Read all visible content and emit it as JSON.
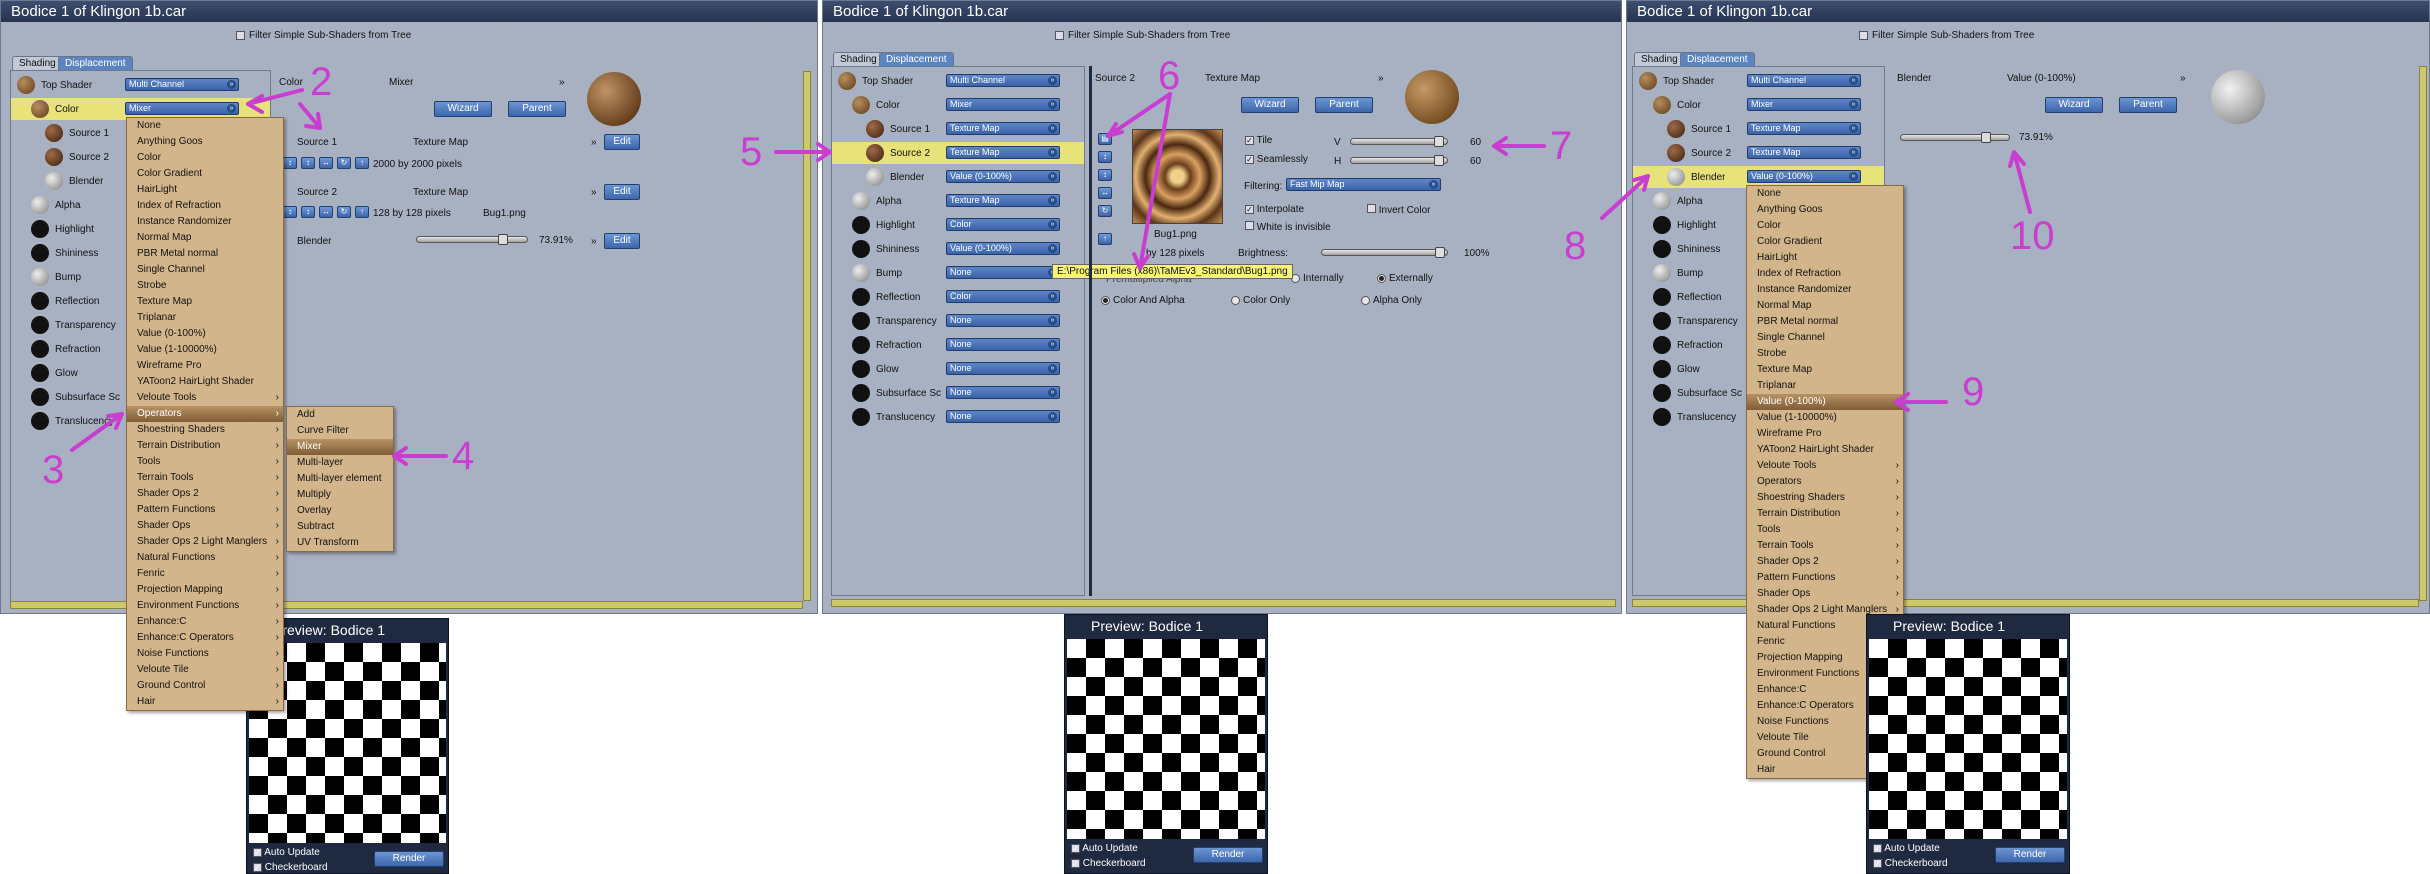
{
  "window_title": "Bodice 1 of Klingon 1b.car",
  "filter_label": "Filter Simple Sub-Shaders from Tree",
  "tabs": [
    "Shading",
    "Displacement"
  ],
  "buttons": {
    "wizard": "Wizard",
    "parent": "Parent",
    "edit": "Edit",
    "render": "Render"
  },
  "preview": {
    "title": "Preview: Bodice 1",
    "auto_update": "Auto Update",
    "checkerboard": "Checkerboard"
  },
  "p1": {
    "tree": [
      {
        "label": "Top Shader",
        "value": "Multi Channel"
      },
      {
        "label": "Color",
        "value": "Mixer"
      },
      {
        "label": "Source 1",
        "value": ""
      },
      {
        "label": "Source 2",
        "value": ""
      },
      {
        "label": "Blender",
        "value": ""
      },
      {
        "label": "Alpha",
        "value": ""
      },
      {
        "label": "Highlight",
        "value": ""
      },
      {
        "label": "Shininess",
        "value": ""
      },
      {
        "label": "Bump",
        "value": ""
      },
      {
        "label": "Reflection",
        "value": ""
      },
      {
        "label": "Transparency",
        "value": ""
      },
      {
        "label": "Refraction",
        "value": ""
      },
      {
        "label": "Glow",
        "value": ""
      },
      {
        "label": "Subsurface Sc",
        "value": ""
      },
      {
        "label": "Translucency",
        "value": ""
      }
    ],
    "header": {
      "channel": "Color",
      "type": "Mixer"
    },
    "source1": {
      "label": "Source 1",
      "type": "Texture Map",
      "info": "2000 by 2000 pixels"
    },
    "source2": {
      "label": "Source 2",
      "type": "Texture Map",
      "info": "128 by 128 pixels",
      "file": "Bug1.png"
    },
    "blender": {
      "label": "Blender",
      "value": "73.91%"
    },
    "menu": [
      "None",
      "Anything Goos",
      "Color",
      "Color Gradient",
      "HairLight",
      "Index of Refraction",
      "Instance Randomizer",
      "Normal Map",
      "PBR Metal normal",
      "Single Channel",
      "Strobe",
      "Texture Map",
      "Triplanar",
      "Value (0-100%)",
      "Value (1-10000%)",
      "Wireframe Pro",
      "YAToon2 HairLight Shader",
      "Veloute Tools",
      "Operators",
      "Shoestring Shaders",
      "Terrain Distribution",
      "Tools",
      "Terrain Tools",
      "Shader Ops 2",
      "Pattern Functions",
      "Shader Ops",
      "Shader Ops 2 Light Manglers",
      "Natural Functions",
      "Fenric",
      "Projection Mapping",
      "Environment Functions",
      "Enhance:C",
      "Enhance:C Operators",
      "Noise Functions",
      "Veloute Tile",
      "Ground Control",
      "Hair"
    ],
    "submenu": [
      "Add",
      "Curve Filter",
      "Mixer",
      "Multi-layer",
      "Multi-layer element",
      "Multiply",
      "Overlay",
      "Subtract",
      "UV Transform"
    ]
  },
  "p2": {
    "tree": [
      {
        "label": "Top Shader",
        "value": "Multi Channel"
      },
      {
        "label": "Color",
        "value": "Mixer"
      },
      {
        "label": "Source 1",
        "value": "Texture Map"
      },
      {
        "label": "Source 2",
        "value": "Texture Map"
      },
      {
        "label": "Blender",
        "value": "Value (0-100%)"
      },
      {
        "label": "Alpha",
        "value": "Texture Map"
      },
      {
        "label": "Highlight",
        "value": "Color"
      },
      {
        "label": "Shininess",
        "value": "Value (0-100%)"
      },
      {
        "label": "Bump",
        "value": "None"
      },
      {
        "label": "Reflection",
        "value": "Color"
      },
      {
        "label": "Transparency",
        "value": "None"
      },
      {
        "label": "Refraction",
        "value": "None"
      },
      {
        "label": "Glow",
        "value": "None"
      },
      {
        "label": "Subsurface Sc",
        "value": "None"
      },
      {
        "label": "Translucency",
        "value": "None"
      }
    ],
    "header": {
      "channel": "Source 2",
      "type": "Texture Map"
    },
    "texture": {
      "filename": "Bug1.png",
      "size": "by 128 pixels",
      "tooltip": "E:\\Program Files (x86)\\TaMEv3_Standard\\Bug1.png",
      "premultiplied": "Premultiplied Alpha"
    },
    "tile": {
      "label": "Tile",
      "v": "V",
      "h": "H",
      "v_value": "60",
      "h_value": "60",
      "seamless": "Seamlessly"
    },
    "filtering": {
      "label": "Filtering:",
      "value": "Fast Mip Map"
    },
    "checks": {
      "interpolate": "Interpolate",
      "invert": "Invert Color",
      "white_invisible": "White is invisible"
    },
    "brightness": {
      "label": "Brightness:",
      "value": "100%"
    },
    "wrap": {
      "internally": "Internally",
      "externally": "Externally"
    },
    "alpha": {
      "color_and_alpha": "Color And Alpha",
      "color_only": "Color Only",
      "alpha_only": "Alpha Only"
    }
  },
  "p3": {
    "tree": [
      {
        "label": "Top Shader",
        "value": "Multi Channel"
      },
      {
        "label": "Color",
        "value": "Mixer"
      },
      {
        "label": "Source 1",
        "value": "Texture Map"
      },
      {
        "label": "Source 2",
        "value": "Texture Map"
      },
      {
        "label": "Blender",
        "value": "Value (0-100%)"
      },
      {
        "label": "Alpha",
        "value": ""
      },
      {
        "label": "Highlight",
        "value": ""
      },
      {
        "label": "Shininess",
        "value": ""
      },
      {
        "label": "Bump",
        "value": ""
      },
      {
        "label": "Reflection",
        "value": ""
      },
      {
        "label": "Transparency",
        "value": ""
      },
      {
        "label": "Refraction",
        "value": ""
      },
      {
        "label": "Glow",
        "value": ""
      },
      {
        "label": "Subsurface Sc",
        "value": ""
      },
      {
        "label": "Translucency",
        "value": ""
      }
    ],
    "header": {
      "channel": "Blender",
      "type": "Value (0-100%)"
    },
    "value": "73.91%",
    "menu": [
      "None",
      "Anything Goos",
      "Color",
      "Color Gradient",
      "HairLight",
      "Index of Refraction",
      "Instance Randomizer",
      "Normal Map",
      "PBR Metal normal",
      "Single Channel",
      "Strobe",
      "Texture Map",
      "Triplanar",
      "Value (0-100%)",
      "Value (1-10000%)",
      "Wireframe Pro",
      "YAToon2 HairLight Shader",
      "Veloute Tools",
      "Operators",
      "Shoestring Shaders",
      "Terrain Distribution",
      "Tools",
      "Terrain Tools",
      "Shader Ops 2",
      "Pattern Functions",
      "Shader Ops",
      "Shader Ops 2 Light Manglers",
      "Natural Functions",
      "Fenric",
      "Projection Mapping",
      "Environment Functions",
      "Enhance:C",
      "Enhance:C Operators",
      "Noise Functions",
      "Veloute Tile",
      "Ground Control",
      "Hair"
    ]
  },
  "annotations": [
    "2",
    "3",
    "4",
    "5",
    "6",
    "7",
    "8",
    "9",
    "10"
  ],
  "colors": {
    "panel": "#a8b1c2",
    "highlight_row": "#e8e27a",
    "menu": "#d3b58c",
    "annotation": "#c93ed0",
    "button": "#4a74b8",
    "title": "#2f3d5c"
  }
}
